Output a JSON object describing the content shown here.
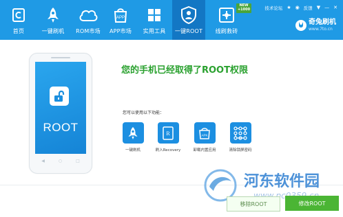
{
  "nav": {
    "items": [
      {
        "label": "首页",
        "icon": "home-icon"
      },
      {
        "label": "一键刷机",
        "icon": "rocket-icon"
      },
      {
        "label": "ROM市场",
        "icon": "cloud-icon"
      },
      {
        "label": "APP市场",
        "icon": "app-bag-icon"
      },
      {
        "label": "实用工具",
        "icon": "grid-icon"
      },
      {
        "label": "一键ROOT",
        "icon": "shield-root-icon"
      },
      {
        "label": "线刷救砖",
        "icon": "flash-rescue-icon"
      }
    ],
    "active": "一键ROOT",
    "badge": {
      "line1": "NEW",
      "line2": "+1000"
    }
  },
  "top_links": {
    "forum": "技术论坛",
    "feedback": "反馈"
  },
  "brand": {
    "name": "奇兔刷机",
    "url": "www.7to.cn"
  },
  "phone": {
    "label": "ROOT"
  },
  "main": {
    "title": "您的手机已经取得了ROOT权限",
    "hint": "您可以使用以下功能："
  },
  "functions": [
    {
      "label": "一键刷机",
      "icon": "rocket-icon"
    },
    {
      "label": "刷入Recovery",
      "icon": "recovery-icon"
    },
    {
      "label": "卸载内置应用",
      "icon": "apk-icon"
    },
    {
      "label": "清除锁屏密码",
      "icon": "pattern-lock-icon"
    }
  ],
  "buttons": {
    "secondary": "移除ROOT",
    "primary": "修改ROOT"
  },
  "watermark": {
    "text": "河东软件园",
    "url": "www.pc0359.cn"
  },
  "colors": {
    "topbar": "#1f9ae5",
    "active_tab": "#1377c4",
    "success": "#2aa12f",
    "primary_button": "#4bb534"
  }
}
